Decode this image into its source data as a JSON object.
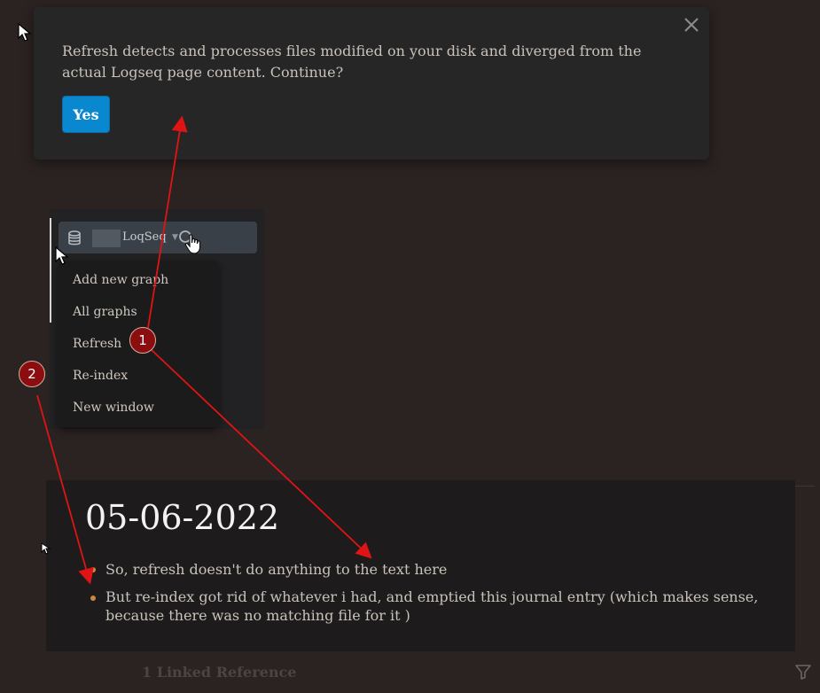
{
  "notification": {
    "message": "Refresh detects and processes files modified on your disk and diverged from the actual Logseq page content. Continue?",
    "confirm_label": "Yes",
    "close_icon": "close-icon"
  },
  "graph_selector": {
    "name": "LoqSeq",
    "db_icon": "database-icon",
    "search_icon": "search-icon"
  },
  "graph_menu": {
    "items": [
      {
        "label": "Add new graph"
      },
      {
        "label": "All graphs"
      },
      {
        "label": "Refresh"
      },
      {
        "label": "Re-index"
      },
      {
        "label": "New window"
      }
    ]
  },
  "journal": {
    "title": "05-06-2022",
    "blocks": [
      {
        "text": "So, refresh doesn't do anything to the text here"
      },
      {
        "text": "But re-index got rid of whatever i had, and emptied this journal entry (which makes sense, because there was no matching file for it )"
      }
    ],
    "bullet_color": "#c98a3a"
  },
  "references": {
    "label": "1 Linked Reference"
  },
  "annotations": {
    "markers": [
      {
        "label": "1"
      },
      {
        "label": "2"
      }
    ],
    "arrow_color": "#e01414"
  },
  "colors": {
    "background": "#2b2322",
    "notification_bg": "#262626",
    "primary_button": "#0a88cf"
  }
}
